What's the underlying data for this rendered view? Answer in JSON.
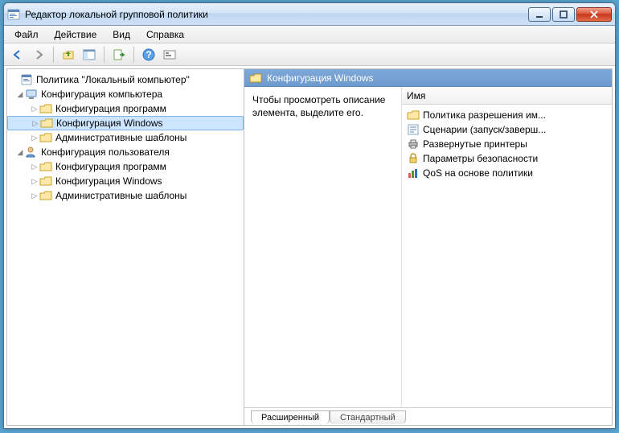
{
  "window": {
    "title": "Редактор локальной групповой политики"
  },
  "menu": {
    "file": "Файл",
    "action": "Действие",
    "view": "Вид",
    "help": "Справка"
  },
  "tree": {
    "root": "Политика \"Локальный компьютер\"",
    "computer_config": "Конфигурация компьютера",
    "software_config": "Конфигурация программ",
    "windows_config": "Конфигурация Windows",
    "admin_templates": "Административные шаблоны",
    "user_config": "Конфигурация пользователя",
    "software_config2": "Конфигурация программ",
    "windows_config2": "Конфигурация Windows",
    "admin_templates2": "Административные шаблоны"
  },
  "header": {
    "title": "Конфигурация Windows"
  },
  "description": "Чтобы просмотреть описание элемента, выделите его.",
  "list": {
    "column": "Имя",
    "items": [
      "Политика разрешения им...",
      "Сценарии (запуск/заверш...",
      "Развернутые принтеры",
      "Параметры безопасности",
      "QoS на основе политики"
    ]
  },
  "tabs": {
    "extended": "Расширенный",
    "standard": "Стандартный"
  }
}
